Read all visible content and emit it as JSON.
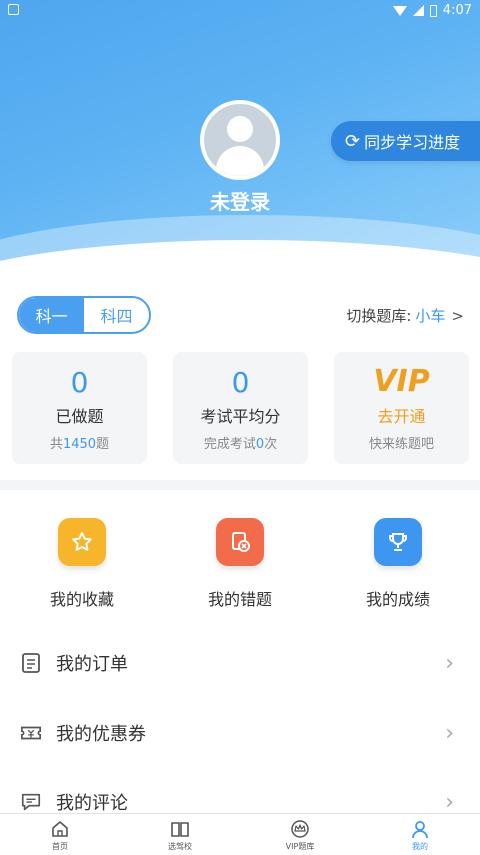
{
  "status_bar": {
    "time": "4:07"
  },
  "profile": {
    "name": "未登录",
    "sync_label": "同步学习进度"
  },
  "subjects": {
    "options": [
      "科一",
      "科四"
    ],
    "selected": "科一"
  },
  "bank_switch": {
    "label": "切换题库:",
    "value": "小车",
    "arrow": ">"
  },
  "stats": [
    {
      "value": "0",
      "label": "已做题",
      "sub_prefix": "共",
      "sub_highlight": "1450",
      "sub_suffix": "题"
    },
    {
      "value": "0",
      "label": "考试平均分",
      "sub_prefix": "完成考试",
      "sub_highlight": "0",
      "sub_suffix": "次"
    },
    {
      "value": "VIP",
      "label": "去开通",
      "sub": "快来练题吧"
    }
  ],
  "quick_entries": [
    {
      "label": "我的收藏",
      "icon": "star-icon",
      "color": "#f6b52a"
    },
    {
      "label": "我的错题",
      "icon": "wrong-question-icon",
      "color": "#f26b4a"
    },
    {
      "label": "我的成绩",
      "icon": "trophy-icon",
      "color": "#3d97f0"
    }
  ],
  "menu_items": [
    {
      "label": "我的订单",
      "icon": "order-icon"
    },
    {
      "label": "我的优惠券",
      "icon": "coupon-icon"
    },
    {
      "label": "我的评论",
      "icon": "comment-icon"
    }
  ],
  "bottom_nav": [
    {
      "label": "首页",
      "icon": "home-icon"
    },
    {
      "label": "选驾校",
      "icon": "book-icon"
    },
    {
      "label": "VIP题库",
      "icon": "crown-icon"
    },
    {
      "label": "我的",
      "icon": "user-icon",
      "active": true
    }
  ],
  "colors": {
    "primary": "#3d97f0",
    "vip": "#f0a020",
    "sync_bg": "#2e86de"
  }
}
